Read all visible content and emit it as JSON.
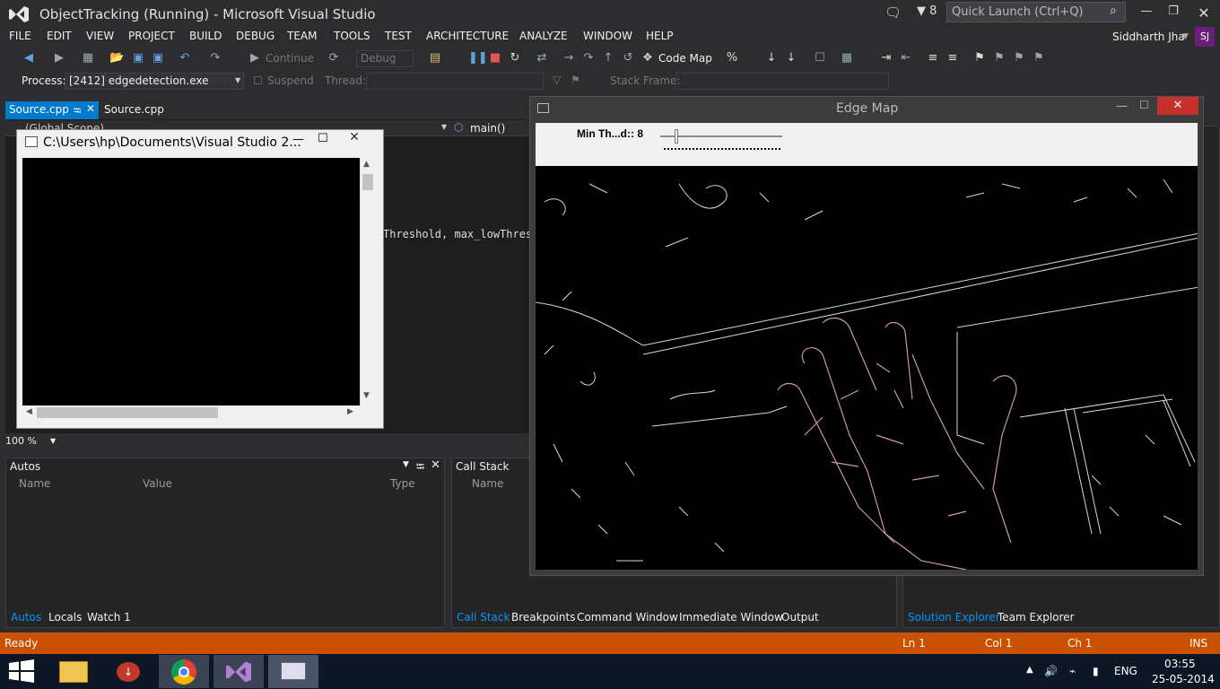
{
  "title_bar": {
    "title": "ObjectTracking (Running) - Microsoft Visual Studio",
    "notification_count": "8",
    "quick_launch_placeholder": "Quick Launch (Ctrl+Q)"
  },
  "menu": [
    "FILE",
    "EDIT",
    "VIEW",
    "PROJECT",
    "BUILD",
    "DEBUG",
    "TEAM",
    "TOOLS",
    "TEST",
    "ARCHITECTURE",
    "ANALYZE",
    "WINDOW",
    "HELP"
  ],
  "user": {
    "name": "Siddharth Jha",
    "initials": "SJ"
  },
  "toolbar1": {
    "continue_label": "Continue",
    "config": "Debug",
    "code_map_label": "Code Map"
  },
  "toolbar2": {
    "process_label": "Process:",
    "process_value": "[2412] edgedetection.exe",
    "suspend_label": "Suspend",
    "thread_label": "Thread:",
    "stack_frame_label": "Stack Frame:"
  },
  "tabs": [
    {
      "label": "Source.cpp",
      "active": true
    },
    {
      "label": "Source.cpp",
      "active": false
    }
  ],
  "nav": {
    "scope": "(Global Scope)",
    "member": "main()"
  },
  "code": {
    "visible_line": "Threshold, max_lowThresh"
  },
  "console": {
    "title": "C:\\Users\\hp\\Documents\\Visual Studio 2..."
  },
  "zoom": "100 %",
  "autos": {
    "title": "Autos",
    "columns": [
      "Name",
      "Value",
      "Type"
    ]
  },
  "callstack": {
    "title": "Call Stack",
    "columns": [
      "Name"
    ]
  },
  "bottom_tabs_left": [
    "Autos",
    "Locals",
    "Watch 1"
  ],
  "bottom_tabs_mid": [
    "Call Stack",
    "Breakpoints",
    "Command Window",
    "Immediate Window",
    "Output"
  ],
  "bottom_tabs_right": [
    "Solution Explorer",
    "Team Explorer"
  ],
  "edge_window": {
    "title": "Edge Map",
    "trackbar_label": "Min Th...d:: 8",
    "trackbar_value": 8
  },
  "status": {
    "ready": "Ready",
    "ln": "Ln 1",
    "col": "Col 1",
    "ch": "Ch 1",
    "ins": "INS"
  },
  "taskbar": {
    "lang": "ENG",
    "time": "03:55",
    "date": "25-05-2014"
  },
  "colors": {
    "accent": "#007acc",
    "status_bar": "#ca5100",
    "vs_purple": "#68217a"
  }
}
